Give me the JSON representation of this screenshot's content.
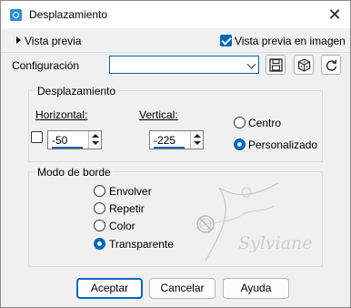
{
  "window": {
    "title": "Desplazamiento",
    "close_glyph": "✕"
  },
  "preview": {
    "label": "Vista previa",
    "live_label": "Vista previa en imagen",
    "live_checked": true
  },
  "config": {
    "label": "Configuración",
    "value": ""
  },
  "displacement": {
    "title": "Desplazamiento",
    "horizontal_label": "Horizontal:",
    "horizontal_value": "-50",
    "vertical_label": "Vertical:",
    "vertical_value": "-225",
    "link_checked": false,
    "options": [
      {
        "label": "Centro",
        "selected": false
      },
      {
        "label": "Personalizado",
        "selected": true
      }
    ]
  },
  "edge_mode": {
    "title": "Modo de borde",
    "options": [
      {
        "label": "Envolver",
        "selected": false
      },
      {
        "label": "Repetir",
        "selected": false
      },
      {
        "label": "Color",
        "selected": false
      },
      {
        "label": "Transparente",
        "selected": true
      }
    ]
  },
  "watermark_text": "Sylviane",
  "buttons": {
    "ok": "Aceptar",
    "cancel": "Cancelar",
    "help": "Ayuda"
  },
  "colors": {
    "accent": "#0067c0",
    "window_bg": "#f0f0f0"
  }
}
